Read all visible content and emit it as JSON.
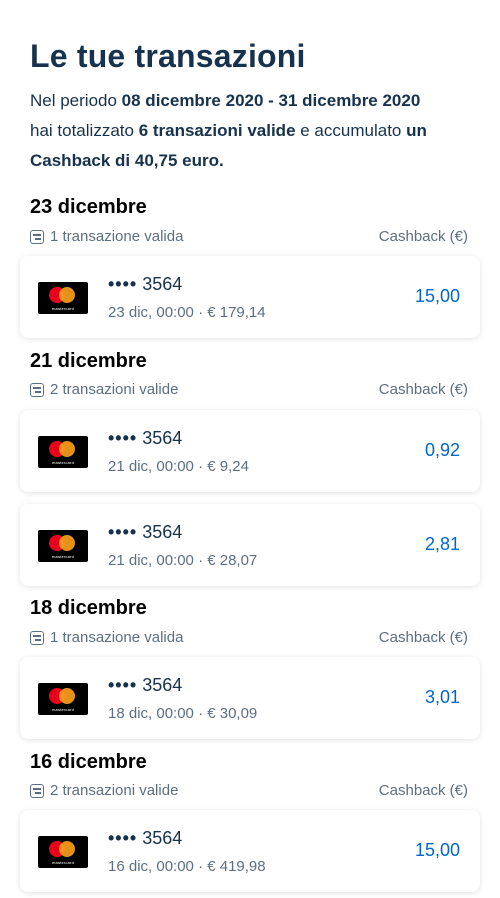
{
  "header": {
    "title": "Le tue transazioni"
  },
  "summary": {
    "prefix": "Nel periodo ",
    "period": "08 dicembre 2020 - 31 dicembre 2020",
    "middle1": "hai totalizzato ",
    "count": "6 transazioni valide",
    "middle2": " e accumulato ",
    "cashback": "un Cashback di 40,75 euro."
  },
  "cashback_header": "Cashback (€)",
  "groups": [
    {
      "date": "23 dicembre",
      "count_label": "1 transazione valida",
      "transactions": [
        {
          "card_dots": "••••",
          "card_last4": "3564",
          "detail": "23 dic, 00:00 · € 179,14",
          "cashback": "15,00"
        }
      ]
    },
    {
      "date": "21 dicembre",
      "count_label": "2 transazioni valide",
      "transactions": [
        {
          "card_dots": "••••",
          "card_last4": "3564",
          "detail": "21 dic, 00:00 · € 9,24",
          "cashback": "0,92"
        },
        {
          "card_dots": "••••",
          "card_last4": "3564",
          "detail": "21 dic, 00:00 · € 28,07",
          "cashback": "2,81"
        }
      ]
    },
    {
      "date": "18 dicembre",
      "count_label": "1 transazione valida",
      "transactions": [
        {
          "card_dots": "••••",
          "card_last4": "3564",
          "detail": "18 dic, 00:00 · € 30,09",
          "cashback": "3,01"
        }
      ]
    },
    {
      "date": "16 dicembre",
      "count_label": "2 transazioni valide",
      "transactions": [
        {
          "card_dots": "••••",
          "card_last4": "3564",
          "detail": "16 dic, 00:00 · € 419,98",
          "cashback": "15,00"
        }
      ]
    }
  ],
  "icons": {
    "card_logo": "mastercard-logo-icon",
    "card_logo_text": "mastercard",
    "transactions_icon": "transactions-icon"
  },
  "colors": {
    "primary_text": "#17324d",
    "secondary_text": "#5c6f82",
    "amount": "#0066cc"
  }
}
